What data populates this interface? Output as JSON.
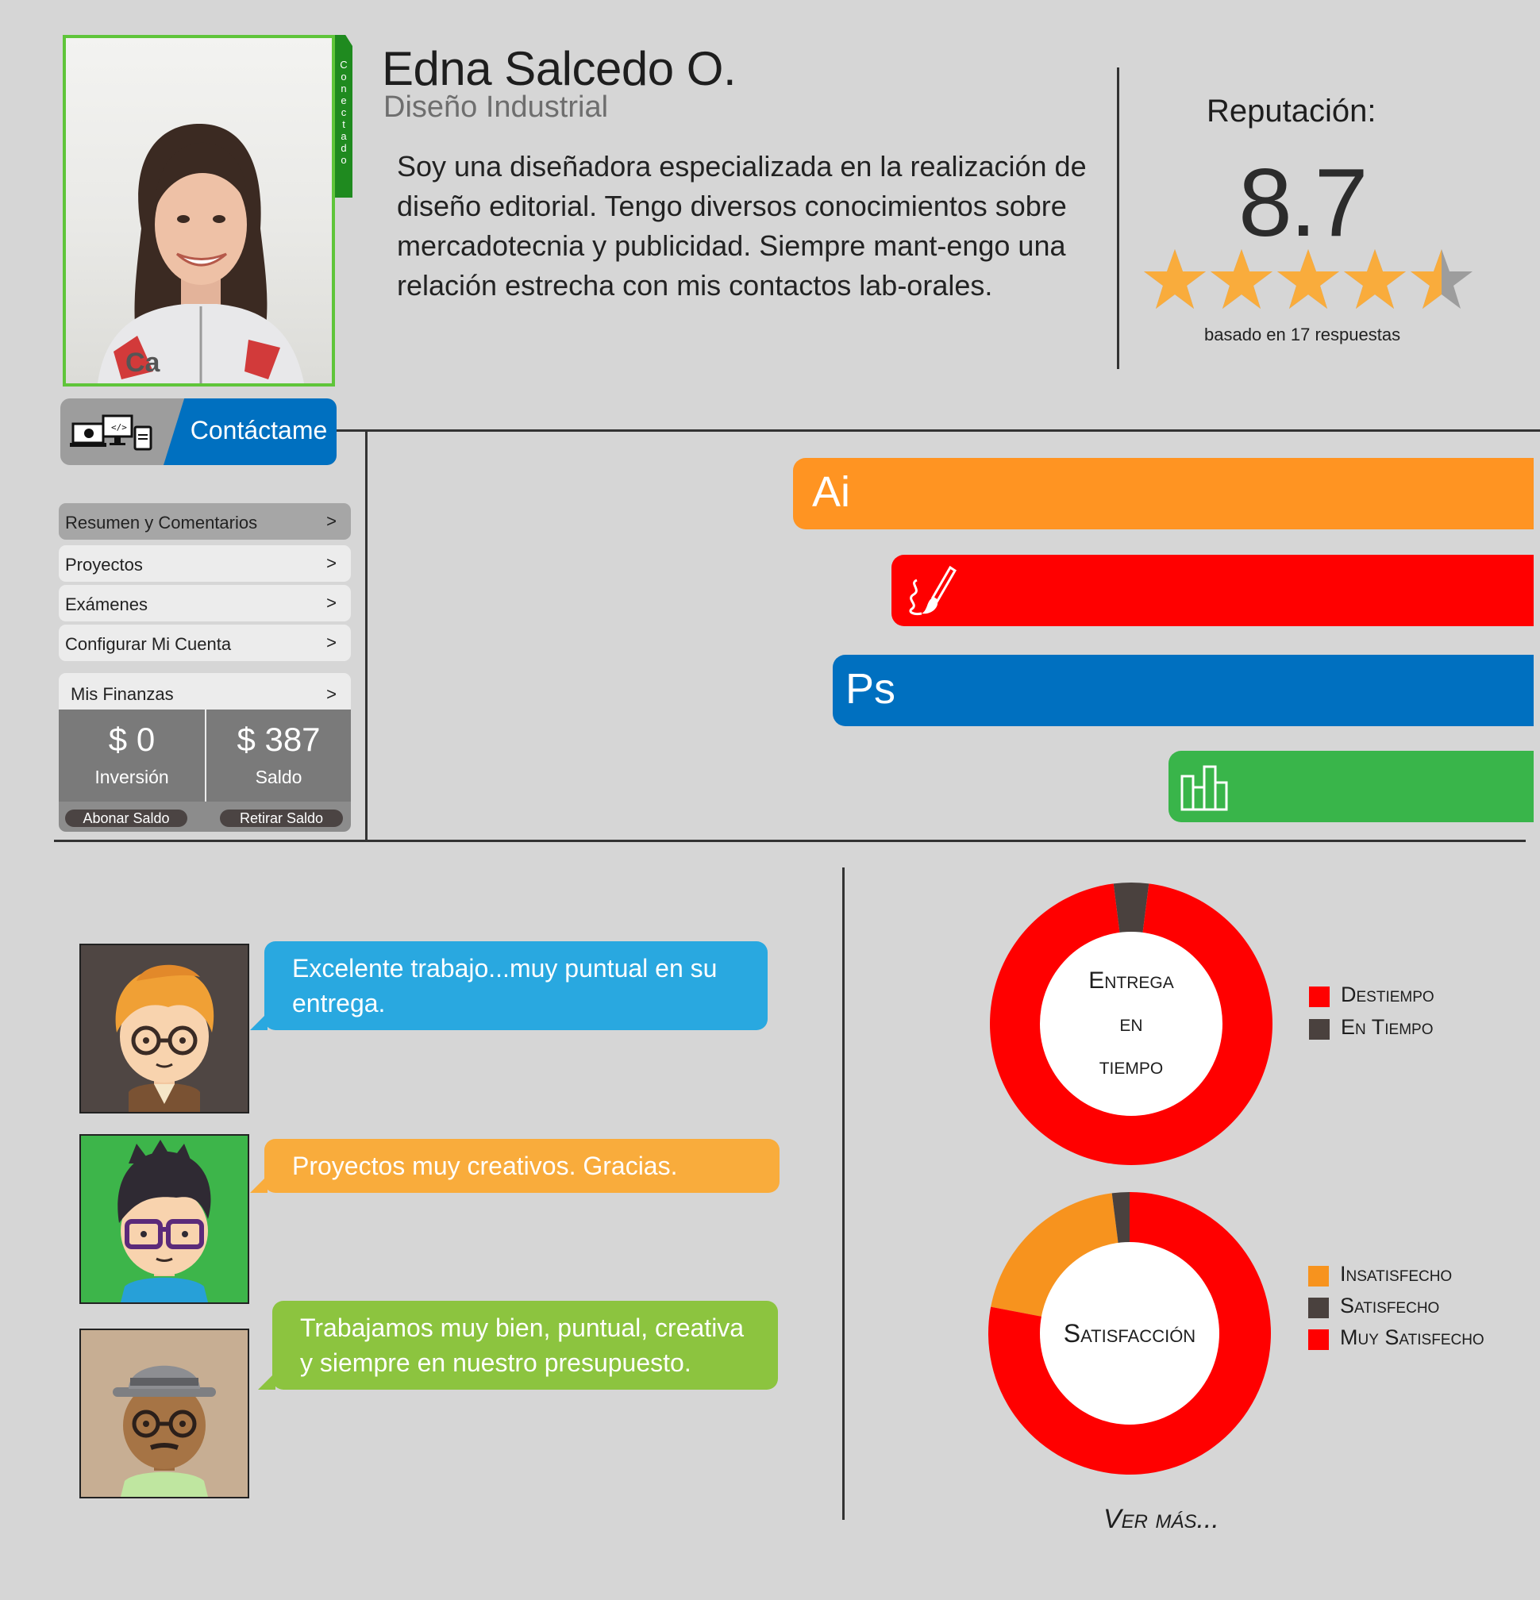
{
  "profile": {
    "name": "Edna Salcedo O.",
    "profession": "Diseño Industrial",
    "status": "Conectado",
    "bio": "Soy una diseñadora especializada en la realización de diseño editorial. Tengo diversos conocimientos sobre mercadotecnia y publicidad. Siempre mant-engo una relación estrecha con mis contactos lab-orales."
  },
  "reputation": {
    "title": "Reputación:",
    "score": "8.7",
    "rating_out_of_5": 4.5,
    "note": "basado en 17 respuestas"
  },
  "contact": {
    "label": "Contáctame",
    "icon": "devices-icon"
  },
  "menu": [
    {
      "label": "Resumen y Comentarios",
      "chevron": ">"
    },
    {
      "label": "Proyectos",
      "chevron": ">"
    },
    {
      "label": "Exámenes",
      "chevron": ">"
    },
    {
      "label": "Configurar Mi Cuenta",
      "chevron": ">"
    }
  ],
  "finance": {
    "title": "Mis Finanzas",
    "chevron": ">",
    "investment": {
      "amount": "$ 0",
      "label": "Inversión"
    },
    "balance": {
      "amount": "$ 387",
      "label": "Saldo"
    },
    "deposit_label": "Abonar Saldo",
    "withdraw_label": "Retirar Saldo"
  },
  "skills": [
    {
      "label": "Ai",
      "icon": "illustrator-icon",
      "color": "#ff9422",
      "level": 0.75
    },
    {
      "label": "",
      "icon": "paintbrush-icon",
      "color": "#ff0000",
      "level": 0.65
    },
    {
      "label": "Ps",
      "icon": "photoshop-icon",
      "color": "#0070c0",
      "level": 0.71
    },
    {
      "label": "",
      "icon": "bar-chart-icon",
      "color": "#39b54a",
      "level": 0.37
    }
  ],
  "comments": [
    {
      "text": "Excelente trabajo...muy puntual en su entrega.",
      "color": "#29a8e0",
      "avatar": "redhead-glasses-avatar"
    },
    {
      "text": "Proyectos muy creativos. Gracias.",
      "color": "#f9ac3c",
      "avatar": "dark-hair-glasses-avatar"
    },
    {
      "text": "Trabajamos muy bien, puntual, creativa y siempre en nuestro presupuesto.",
      "color": "#8cc43f",
      "avatar": "hat-glasses-avatar"
    }
  ],
  "chart_data": [
    {
      "type": "pie",
      "title": "Entrega en tiempo",
      "categories": [
        "Destiempo",
        "En Tiempo"
      ],
      "values": [
        96,
        4
      ],
      "colors": [
        "#ff0000",
        "#4a413e"
      ]
    },
    {
      "type": "pie",
      "title": "Satisfacción",
      "categories": [
        "Insatisfecho",
        "Satisfecho",
        "Muy Satisfecho"
      ],
      "values": [
        20,
        2,
        78
      ],
      "colors": [
        "#f7931e",
        "#4a413e",
        "#ff0000"
      ]
    }
  ],
  "donut1": {
    "line1": "Entrega",
    "line2": "en",
    "line3": "tiempo"
  },
  "donut2": {
    "label": "Satisfacción"
  },
  "ver_mas": "Ver más..."
}
